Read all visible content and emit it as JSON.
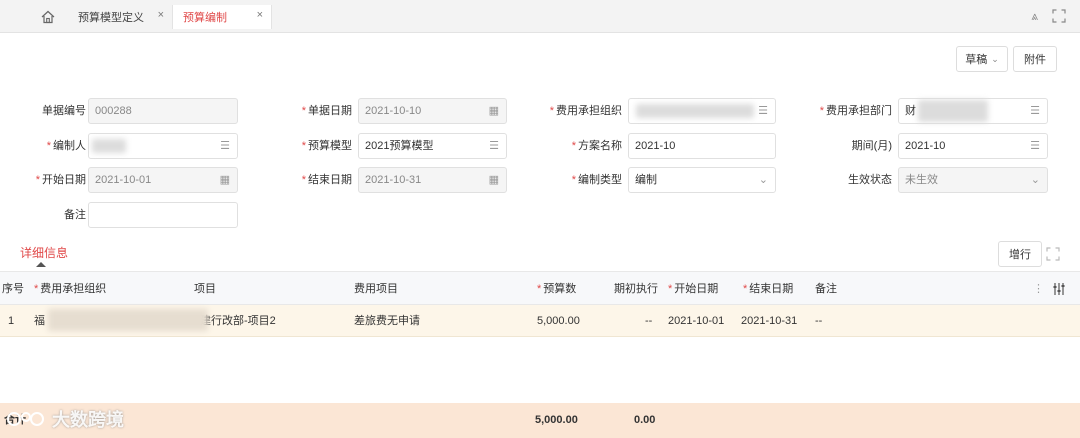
{
  "tabs": [
    {
      "label": "预算模型定义",
      "close": "×"
    },
    {
      "label": "预算编制",
      "close": "×"
    }
  ],
  "topbar": {
    "collapse_glyph": "⩓"
  },
  "actions": {
    "draft_label": "草稿",
    "draft_chevron": "⌄",
    "attach_label": "附件"
  },
  "form": {
    "doc_no": {
      "label": "单据编号",
      "value": "000288"
    },
    "doc_date": {
      "label": "单据日期",
      "value": "2021-10-10"
    },
    "cost_org": {
      "label": "费用承担组织",
      "value": ""
    },
    "cost_dept": {
      "label": "费用承担部门",
      "value": "财"
    },
    "creator": {
      "label": "编制人",
      "value": ""
    },
    "model": {
      "label": "预算模型",
      "value": "2021预算模型"
    },
    "plan_name": {
      "label": "方案名称",
      "value": "2021-10"
    },
    "period": {
      "label": "期间(月)",
      "value": "2021-10"
    },
    "start_date": {
      "label": "开始日期",
      "value": "2021-10-01"
    },
    "end_date": {
      "label": "结束日期",
      "value": "2021-10-31"
    },
    "type": {
      "label": "编制类型",
      "value": "编制"
    },
    "status": {
      "label": "生效状态",
      "value": "未生效"
    },
    "remark": {
      "label": "备注",
      "value": ""
    }
  },
  "detail": {
    "title": "详细信息",
    "add_row_label": "增行"
  },
  "table": {
    "headers": {
      "seq": "序号",
      "org": "费用承担组织",
      "project": "项目",
      "expense": "费用项目",
      "budget": "预算数",
      "initial": "期初执行",
      "start": "开始日期",
      "end": "结束日期",
      "remark": "备注"
    },
    "rows": [
      {
        "seq": "1",
        "org": "福",
        "project": "建行改部-项目2",
        "expense": "差旅费无申请",
        "budget": "5,000.00",
        "initial": "--",
        "start": "2021-10-01",
        "end": "2021-10-31",
        "remark": "--"
      }
    ],
    "footer": {
      "label": "合计",
      "budget": "5,000.00",
      "initial": "0.00"
    }
  },
  "watermark": {
    "text": "大数跨境"
  },
  "colors": {
    "accent": "#e04848",
    "row_bg": "#fdf6e9",
    "footer_bg": "#fbe6d5"
  }
}
